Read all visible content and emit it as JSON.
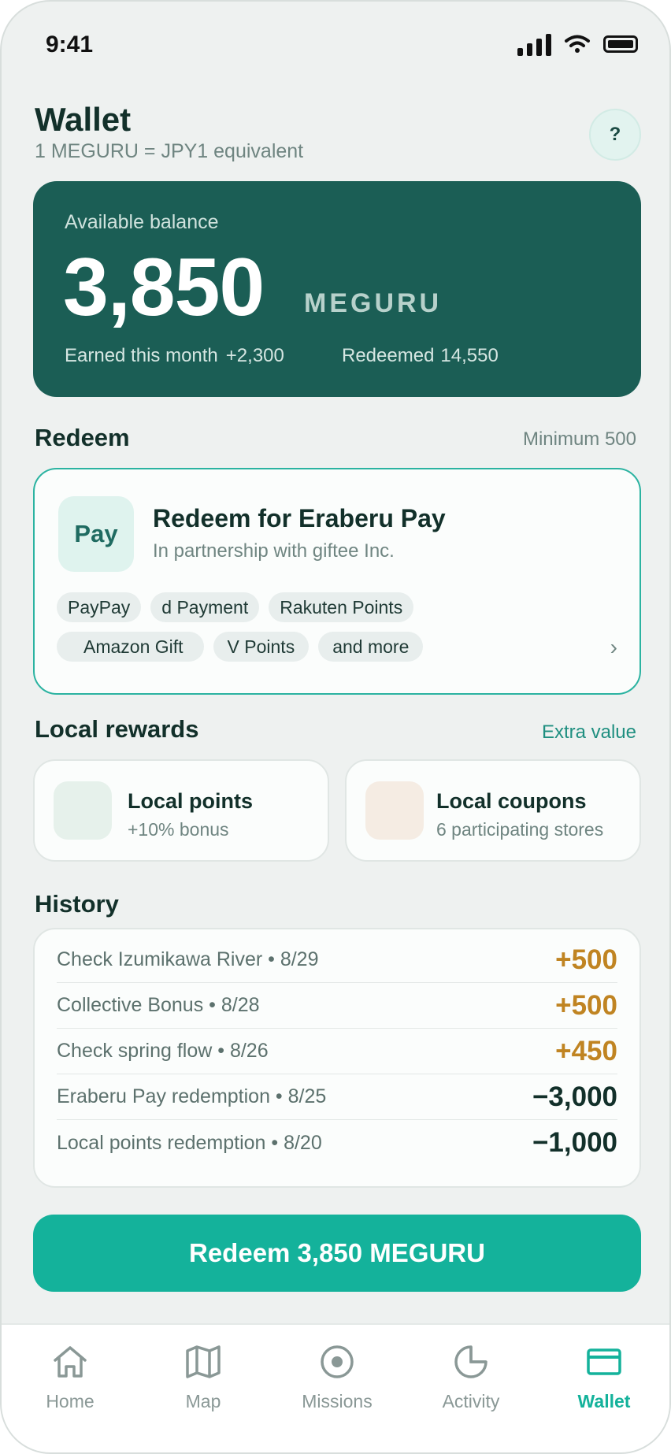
{
  "status_bar": {
    "time": "9:41"
  },
  "header": {
    "title": "Wallet",
    "subtitle": "1 MEGURU = JPY1 equivalent",
    "help_label": "?"
  },
  "balance": {
    "label": "Available balance",
    "amount": "3,850",
    "unit": "MEGURU",
    "earned_label": "Earned this month",
    "earned_value": "+2,300",
    "redeemed_label": "Redeemed",
    "redeemed_value": "14,550"
  },
  "redeem": {
    "section_title": "Redeem",
    "minimum": "Minimum 500",
    "tile_label": "Pay",
    "title": "Redeem for Eraberu Pay",
    "subtitle": "In partnership with giftee Inc.",
    "chips": [
      "PayPay",
      "d Payment",
      "Rakuten Points",
      "Amazon Gift",
      "V Points",
      "and more"
    ]
  },
  "local_rewards": {
    "section_title": "Local rewards",
    "extra": "Extra value",
    "cards": [
      {
        "title": "Local points",
        "subtitle": "+10% bonus"
      },
      {
        "title": "Local coupons",
        "subtitle": "6 participating stores"
      }
    ]
  },
  "history": {
    "section_title": "History",
    "rows": [
      {
        "label": "Check Izumikawa River • 8/29",
        "amount": "+500"
      },
      {
        "label": "Collective Bonus • 8/28",
        "amount": "+500"
      },
      {
        "label": "Check spring flow • 8/26",
        "amount": "+450"
      },
      {
        "label": "Eraberu Pay redemption • 8/25",
        "amount": "−3,000"
      },
      {
        "label": "Local points redemption • 8/20",
        "amount": "−1,000"
      }
    ]
  },
  "cta": {
    "label": "Redeem 3,850 MEGURU"
  },
  "tabs": [
    {
      "label": "Home",
      "icon": "home-icon"
    },
    {
      "label": "Map",
      "icon": "map-icon"
    },
    {
      "label": "Missions",
      "icon": "target-icon"
    },
    {
      "label": "Activity",
      "icon": "pie-chart-icon"
    },
    {
      "label": "Wallet",
      "icon": "wallet-icon",
      "active": true
    }
  ],
  "colors": {
    "brand_dark": "#1b5e55",
    "accent": "#14b29b",
    "positive_amount": "#c08422",
    "background": "#eef1f0"
  }
}
